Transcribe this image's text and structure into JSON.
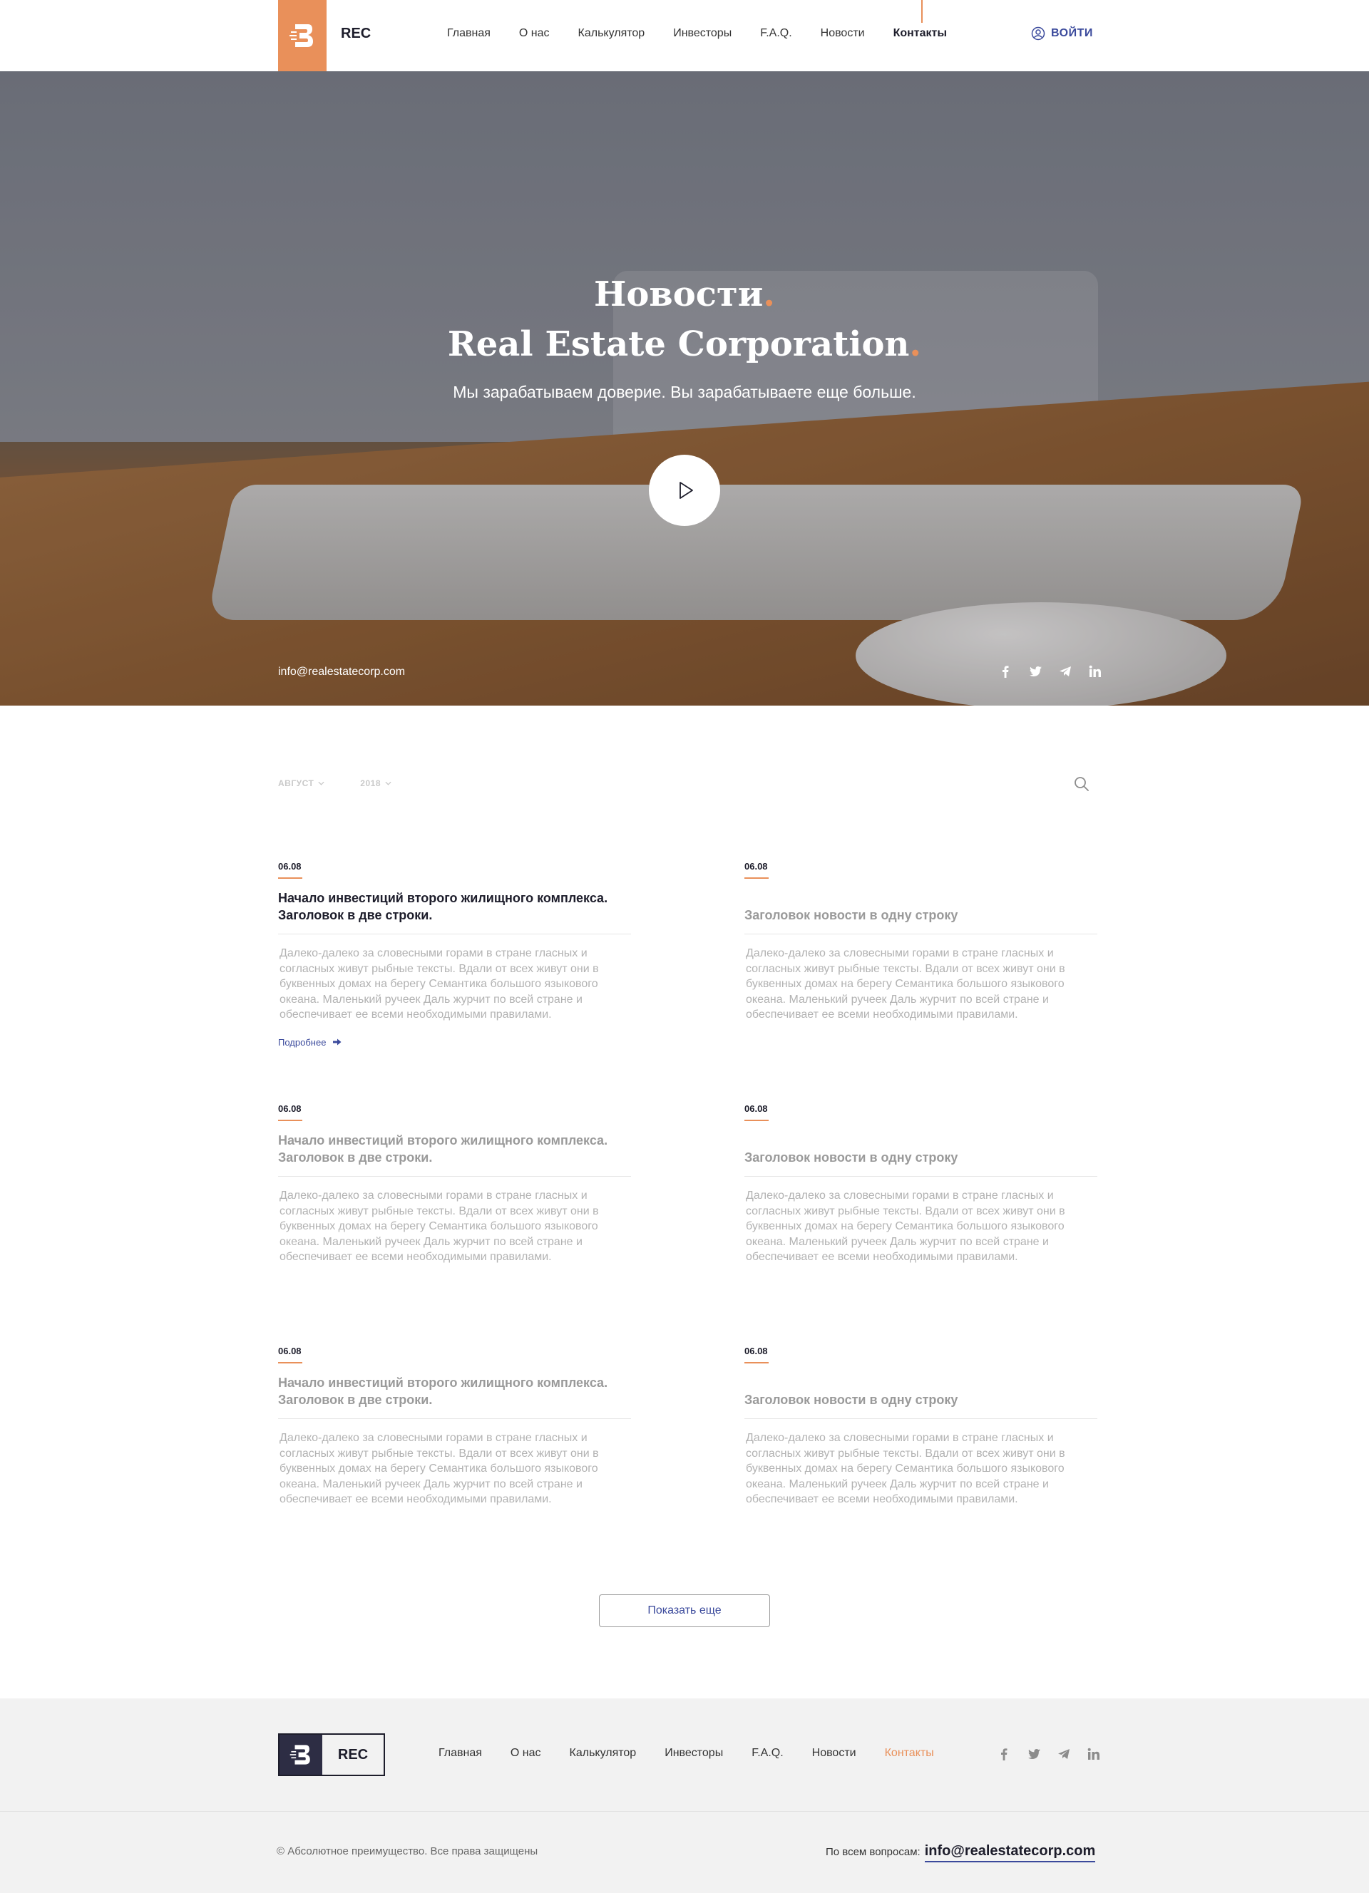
{
  "header": {
    "logo_text": "REC",
    "nav": [
      "Главная",
      "О нас",
      "Калькулятор",
      "Инвесторы",
      "F.A.Q.",
      "Новости",
      "Контакты"
    ],
    "active_nav": "Контакты",
    "login": "ВОЙТИ"
  },
  "hero": {
    "title1": "Новости",
    "title2": "Real Estate Corporation",
    "dot": ".",
    "subtitle": "Мы зарабатываем доверие. Вы зарабатываете еще больше.",
    "email": "info@realestatecorp.com",
    "social": [
      "facebook-icon",
      "twitter-icon",
      "telegram-icon",
      "linkedin-icon"
    ]
  },
  "filters": {
    "month": "АВГУСТ",
    "year": "2018"
  },
  "news": [
    {
      "date": "06.08",
      "title_line1": "Начало инвестиций второго жилищного комплекса.",
      "title_line2": "Заголовок в две строки.",
      "text": "Далеко-далеко за словесными горами в стране гласных и согласных живут рыбные тексты. Вдали от всех живут они в буквенных домах на берегу Семантика большого языкового океана. Маленький ручеек Даль журчит по всей стране и обеспечивает ее всеми необходимыми правилами.",
      "more": "Подробнее"
    },
    {
      "date": "06.08",
      "title_line1": "",
      "title_line2": "Заголовок новости в одну строку",
      "text": "Далеко-далеко за словесными горами в стране гласных и согласных живут рыбные тексты. Вдали от всех живут они в буквенных домах на берегу Семантика большого языкового океана. Маленький ручеек Даль журчит по всей стране и обеспечивает ее всеми необходимыми правилами."
    },
    {
      "date": "06.08",
      "title_line1": "Начало инвестиций второго жилищного комплекса.",
      "title_line2": "Заголовок в две строки.",
      "text": "Далеко-далеко за словесными горами в стране гласных и согласных живут рыбные тексты. Вдали от всех живут они в буквенных домах на берегу Семантика большого языкового океана. Маленький ручеек Даль журчит по всей стране и обеспечивает ее всеми необходимыми правилами."
    },
    {
      "date": "06.08",
      "title_line1": "",
      "title_line2": "Заголовок новости в одну строку",
      "text": "Далеко-далеко за словесными горами в стране гласных и согласных живут рыбные тексты. Вдали от всех живут они в буквенных домах на берегу Семантика большого языкового океана. Маленький ручеек Даль журчит по всей стране и обеспечивает ее всеми необходимыми правилами."
    },
    {
      "date": "06.08",
      "title_line1": "Начало инвестиций второго жилищного комплекса.",
      "title_line2": "Заголовок в две строки.",
      "text": "Далеко-далеко за словесными горами в стране гласных и согласных живут рыбные тексты. Вдали от всех живут они в буквенных домах на берегу Семантика большого языкового океана. Маленький ручеек Даль журчит по всей стране и обеспечивает ее всеми необходимыми правилами."
    },
    {
      "date": "06.08",
      "title_line1": "",
      "title_line2": "Заголовок новости в одну строку",
      "text": "Далеко-далеко за словесными горами в стране гласных и согласных живут рыбные тексты. Вдали от всех живут они в буквенных домах на берегу Семантика большого языкового океана. Маленький ручеек Даль журчит по всей стране и обеспечивает ее всеми необходимыми правилами."
    }
  ],
  "show_more": "Показать еще",
  "footer": {
    "logo_text": "REC",
    "nav": [
      "Главная",
      "О нас",
      "Калькулятор",
      "Инвесторы",
      "F.A.Q.",
      "Новости",
      "Контакты"
    ],
    "copyright": "© Абсолютное преимущество. Все права защищены",
    "contact_label": "По всем вопросам:",
    "contact_email": "info@realestatecorp.com"
  },
  "colors": {
    "accent": "#e9905a",
    "link": "#3b4a9c",
    "dark": "#1d1d2b"
  }
}
